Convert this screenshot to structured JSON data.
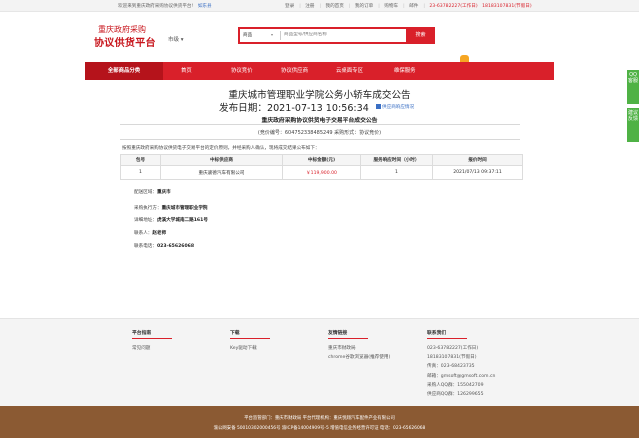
{
  "topbar": {
    "welcome": "欢迎来到重庆政府采购协议供货平台!",
    "area": "如东县",
    "links": [
      "登录",
      "注册",
      "我的首页",
      "我的订单",
      "购物车",
      "邮件",
      "咨询(6378227)"
    ],
    "phone_label": "23-63782227(工作日)",
    "phone2": "18183107831(节假日)"
  },
  "logo": {
    "line1": "重庆政府采购",
    "line2": "协议供货平台"
  },
  "city_selector": {
    "label": "市级",
    "caret": "▾"
  },
  "search": {
    "type": "商品",
    "caret": "▾",
    "placeholder": "商品型号/供应商名称",
    "button": "搜索"
  },
  "nav": {
    "category": "全部商品分类",
    "items": [
      "首页",
      "协议竞价",
      "协议供应商",
      "云桌面专区",
      "维保服务"
    ]
  },
  "notice": {
    "title": "重庆城市管理职业学院公务小轿车成交公告",
    "pub_label": "发布日期：",
    "pub_date": "2021-07-13 10:56:34",
    "rate_link": "供应商响应情况",
    "subtitle": "重庆政府采购协议供货电子交易平台成交公告",
    "meta": "(竞价编号：604752338485249    采购形式：协议竞价)",
    "intro": "按照重庆政府采购协议供货电子交易平台的定价原则，并经采购人确认，现将成交结果公布如下："
  },
  "result_table": {
    "headers": [
      "包号",
      "中标供应商",
      "中标金额(元)",
      "服务响应时间（小时）",
      "报价时间"
    ],
    "rows": [
      [
        "1",
        "重庆骏德汽车有限公司",
        "￥119,900.00",
        "1",
        "2021/07/13 09:37:11"
      ]
    ]
  },
  "delivery": {
    "area_label": "配送区域：",
    "area": "重庆市",
    "unit_label": "采购执行方：",
    "unit": "重庆城市管理职业学院",
    "address_label": "详细地址：",
    "address": "虎溪大学城南二路161号",
    "contact_label": "联系人：",
    "contact": "赵老师",
    "phone_label": "联系电话：",
    "phone": "023-65626068"
  },
  "footer": {
    "col1": {
      "title": "平台指南",
      "items": [
        "常见问题"
      ]
    },
    "col2": {
      "title": "下载",
      "items": [
        "Key驱动下载"
      ]
    },
    "col3": {
      "title": "友情链接",
      "items": [
        "重庆市财政局",
        "chrome谷歌浏览器(推荐使用)"
      ]
    },
    "col4": {
      "title": "联系我们",
      "items": [
        "023-63782227(工作日)",
        "18183107831(节假日)",
        "传真：023-68423735",
        "邮箱：gmsoft@gmsoft.com.cn",
        "采购人QQ群：155042709",
        "供应商QQ群：126299655"
      ]
    }
  },
  "bottom": {
    "line1": "平台监管部门：重庆市财政局    平台代理机构：重庆悦翔汽车配件产业有限公司",
    "line2": "渝公网安备 50010302000456号    渝ICP备14004909号-5    增值电信业务经营许可证    电话：023-65626068"
  },
  "side": {
    "qq": "QQ客服",
    "feedback": "建议反馈"
  },
  "colors": {
    "brand_red": "#d9202a",
    "nav_dark": "#b5131b",
    "footer_brown": "#8b5a33",
    "side_green": "#4fb245"
  }
}
